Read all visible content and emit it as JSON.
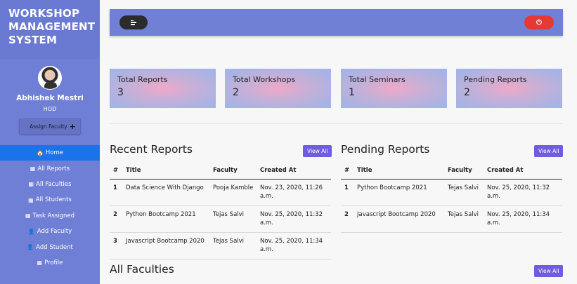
{
  "sidebar": {
    "brand_line1": "WORKSHOP",
    "brand_line2": "MANAGEMENT",
    "brand_line3": "SYSTEM",
    "user_name": "Abhishek Mestri",
    "user_role": "HOD",
    "assign_label": "Assign Faculty",
    "assign_icon": "+",
    "items": [
      {
        "label": "Home",
        "icon": "home-icon",
        "glyph": "🏠"
      },
      {
        "label": "All Reports",
        "icon": "building-icon",
        "glyph": "▦"
      },
      {
        "label": "All Faculties",
        "icon": "building-icon",
        "glyph": "▦"
      },
      {
        "label": "All Students",
        "icon": "building-icon",
        "glyph": "▦"
      },
      {
        "label": "Task Assigned",
        "icon": "building-icon",
        "glyph": "▦"
      },
      {
        "label": "Add Faculty",
        "icon": "user-icon",
        "glyph": "👤"
      },
      {
        "label": "Add Student",
        "icon": "user-icon",
        "glyph": "👤"
      },
      {
        "label": "Profile",
        "icon": "building-icon",
        "glyph": "▦"
      }
    ]
  },
  "topbar": {
    "menu_icon": "menu-icon",
    "power_icon": "power-icon",
    "power_glyph": "⏻",
    "accent": "#7080d5",
    "danger": "#e53935"
  },
  "cards": [
    {
      "label": "Total Reports",
      "value": "3"
    },
    {
      "label": "Total Workshops",
      "value": "2"
    },
    {
      "label": "Total Seminars",
      "value": "1"
    },
    {
      "label": "Pending Reports",
      "value": "2"
    }
  ],
  "recent": {
    "title": "Recent Reports",
    "view_all": "View All",
    "headers": [
      "#",
      "Title",
      "Faculty",
      "Created At"
    ],
    "rows": [
      [
        "1",
        "Data Science With Django",
        "Pooja Kamble",
        "Nov. 23, 2020, 11:26 a.m."
      ],
      [
        "2",
        "Python Bootcamp 2021",
        "Tejas Salvi",
        "Nov. 25, 2020, 11:32 a.m."
      ],
      [
        "3",
        "Javascript Bootcamp 2020",
        "Tejas Salvi",
        "Nov. 25, 2020, 11:34 a.m."
      ]
    ]
  },
  "pending": {
    "title": "Pending Reports",
    "view_all": "View All",
    "headers": [
      "#",
      "Title",
      "Faculty",
      "Created At"
    ],
    "rows": [
      [
        "1",
        "Python Bootcamp 2021",
        "Tejas Salvi",
        "Nov. 25, 2020, 11:32 a.m."
      ],
      [
        "2",
        "Javascript Bootcamp 2020",
        "Tejas Salvi",
        "Nov. 25, 2020, 11:34 a.m."
      ]
    ]
  },
  "faculties": {
    "title": "All Faculties",
    "view_all": "View All"
  }
}
